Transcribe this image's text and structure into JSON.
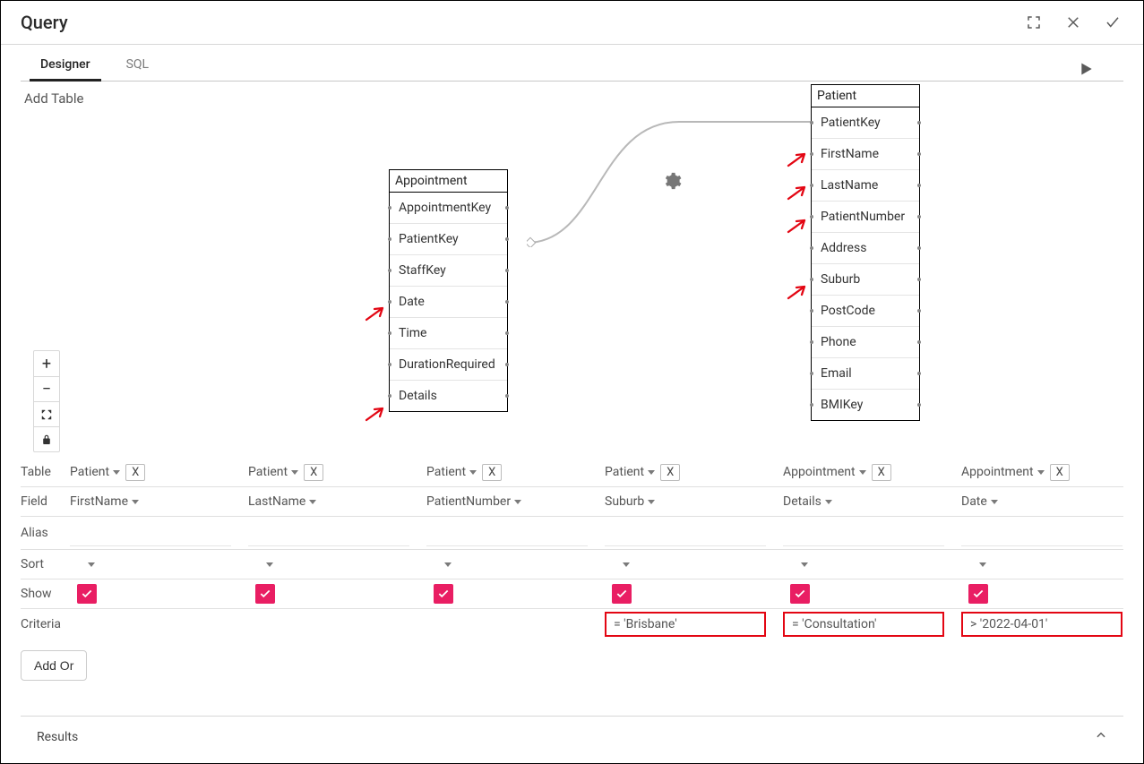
{
  "title": "Query",
  "tabs": {
    "designer": "Designer",
    "sql": "SQL"
  },
  "add_table": "Add Table",
  "entities": {
    "appointment": {
      "name": "Appointment",
      "fields": [
        "AppointmentKey",
        "PatientKey",
        "StaffKey",
        "Date",
        "Time",
        "DurationRequired",
        "Details"
      ]
    },
    "patient": {
      "name": "Patient",
      "fields": [
        "PatientKey",
        "FirstName",
        "LastName",
        "PatientNumber",
        "Address",
        "Suburb",
        "PostCode",
        "Phone",
        "Email",
        "BMIKey"
      ]
    }
  },
  "grid": {
    "labels": {
      "table": "Table",
      "field": "Field",
      "alias": "Alias",
      "sort": "Sort",
      "show": "Show",
      "criteria": "Criteria"
    },
    "columns": [
      {
        "table": "Patient",
        "field": "FirstName",
        "alias": "",
        "sort": "",
        "show": true,
        "criteria": "",
        "criteria_highlight": false
      },
      {
        "table": "Patient",
        "field": "LastName",
        "alias": "",
        "sort": "",
        "show": true,
        "criteria": "",
        "criteria_highlight": false
      },
      {
        "table": "Patient",
        "field": "PatientNumber",
        "alias": "",
        "sort": "",
        "show": true,
        "criteria": "",
        "criteria_highlight": false
      },
      {
        "table": "Patient",
        "field": "Suburb",
        "alias": "",
        "sort": "",
        "show": true,
        "criteria": "=  'Brisbane'",
        "criteria_highlight": true
      },
      {
        "table": "Appointment",
        "field": "Details",
        "alias": "",
        "sort": "",
        "show": true,
        "criteria": "=  'Consultation'",
        "criteria_highlight": true
      },
      {
        "table": "Appointment",
        "field": "Date",
        "alias": "",
        "sort": "",
        "show": true,
        "criteria": ">   '2022-04-01'",
        "criteria_highlight": true
      }
    ],
    "x_label": "X",
    "add_or": "Add Or"
  },
  "results": "Results"
}
